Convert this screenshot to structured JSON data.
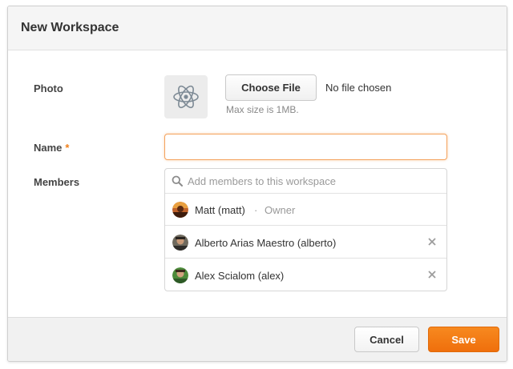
{
  "modal": {
    "title": "New Workspace"
  },
  "photo": {
    "label": "Photo",
    "thumb_icon": "atom-icon",
    "choose_button_label": "Choose File",
    "file_status": "No file chosen",
    "hint": "Max size is 1MB."
  },
  "name": {
    "label": "Name",
    "required_marker": "*",
    "value": ""
  },
  "members": {
    "label": "Members",
    "search_placeholder": "Add members to this workspace",
    "items": [
      {
        "name": "Matt (matt)",
        "separator": "·",
        "role": "Owner",
        "removable": false
      },
      {
        "name": "Alberto Arias Maestro (alberto)",
        "removable": true
      },
      {
        "name": "Alex Scialom (alex)",
        "removable": true
      }
    ],
    "remove_glyph": "×"
  },
  "footer": {
    "cancel_label": "Cancel",
    "save_label": "Save"
  },
  "colors": {
    "accent": "#f0801a",
    "save_button": "#ef7a13",
    "focus_border": "#f4a35e"
  }
}
